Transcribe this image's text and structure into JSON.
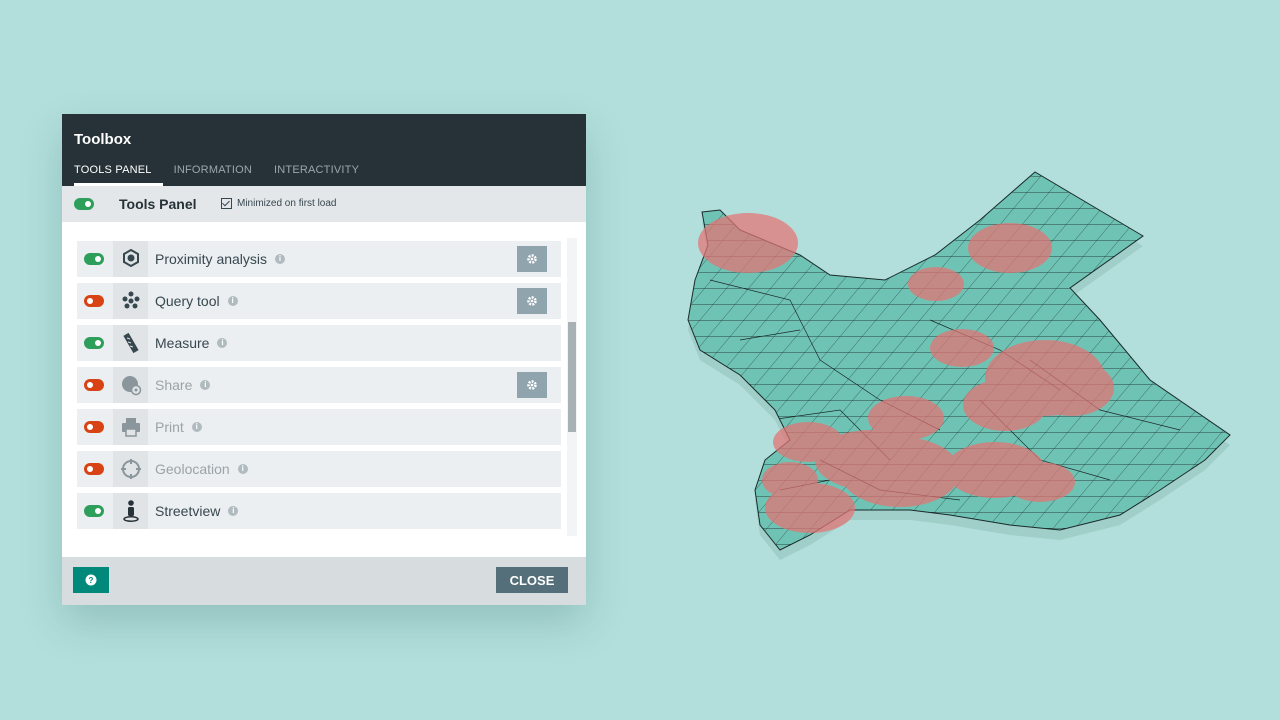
{
  "dialog": {
    "title": "Toolbox",
    "tabs": [
      {
        "label": "TOOLS PANEL",
        "active": true
      },
      {
        "label": "INFORMATION",
        "active": false
      },
      {
        "label": "INTERACTIVITY",
        "active": false
      }
    ]
  },
  "panel": {
    "title": "Tools Panel",
    "enabled": true,
    "minimized_label": "Minimized on first load",
    "minimized_checked": true
  },
  "tools": [
    {
      "label": "Proximity analysis",
      "enabled": true,
      "icon": "hexagon-network-icon",
      "has_settings": true,
      "disabled": false
    },
    {
      "label": "Query tool",
      "enabled": false,
      "icon": "dots-cluster-icon",
      "has_settings": true,
      "disabled": false
    },
    {
      "label": "Measure",
      "enabled": true,
      "icon": "ruler-icon",
      "has_settings": false,
      "disabled": false
    },
    {
      "label": "Share",
      "enabled": false,
      "icon": "globe-share-icon",
      "has_settings": true,
      "disabled": true
    },
    {
      "label": "Print",
      "enabled": false,
      "icon": "printer-icon",
      "has_settings": false,
      "disabled": true
    },
    {
      "label": "Geolocation",
      "enabled": false,
      "icon": "crosshair-icon",
      "has_settings": false,
      "disabled": true
    },
    {
      "label": "Streetview",
      "enabled": true,
      "icon": "pegman-icon",
      "has_settings": false,
      "disabled": false
    }
  ],
  "footer": {
    "help_icon": "question-icon",
    "close_label": "CLOSE"
  },
  "colors": {
    "background": "#b2dfdb",
    "header": "#263238",
    "toggle_on": "#2e9e5b",
    "toggle_off": "#d84315",
    "help_button": "#00897b",
    "close_button": "#546e7a",
    "map_fill": "#6fc3b4",
    "hotspot": "#e57373"
  }
}
